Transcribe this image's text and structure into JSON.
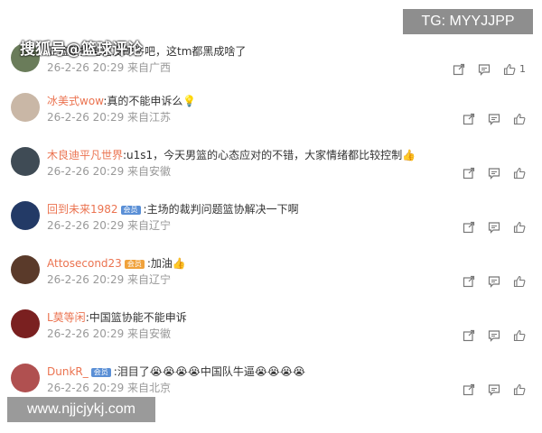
{
  "overlay": {
    "tag": "TG: MYYJJPP",
    "source": "搜狐号@篮球评论",
    "url": "www.njjcjykj.com"
  },
  "comments": [
    {
      "name": "",
      "text": "亚篮联打电话发邮件吧，这tm都黑成啥了",
      "meta": "26-2-26 20:29 来自广西",
      "likes": "1",
      "avatar_color": "#6a7c5a"
    },
    {
      "name": "冰美式wow",
      "text": ":真的不能申诉么💡",
      "meta": "26-2-26 20:29 来自江苏",
      "likes": "",
      "avatar_color": "#c9b7a6"
    },
    {
      "name": "木良迪平凡世界",
      "text": ":u1s1，今天男篮的心态应对的不错，大家情绪都比较控制👍",
      "meta": "26-2-26 20:29 来自安徽",
      "likes": "",
      "avatar_color": "#3f4b55"
    },
    {
      "name": "回到未来1982",
      "badge": "会员",
      "badge_color": "blue",
      "text": ":主场的裁判问题篮协解决一下啊",
      "meta": "26-2-26 20:29 来自辽宁",
      "likes": "",
      "avatar_color": "#233a66"
    },
    {
      "name": "Attosecond23",
      "badge": "会员",
      "badge_color": "gold",
      "text": ":加油👍",
      "meta": "26-2-26 20:29 来自辽宁",
      "likes": "",
      "avatar_color": "#5a3a2a"
    },
    {
      "name": "L莫等闲",
      "text": ":中国篮协能不能申诉",
      "meta": "26-2-26 20:29 来自安徽",
      "likes": "",
      "avatar_color": "#7a2020"
    },
    {
      "name": "DunkR_",
      "badge": "会员",
      "badge_color": "blue",
      "text": ":泪目了😭😭😭😭中国队牛逼😭😭😭😭",
      "meta": "26-2-26 20:29 来自北京",
      "likes": "",
      "avatar_color": "#b05050"
    }
  ]
}
